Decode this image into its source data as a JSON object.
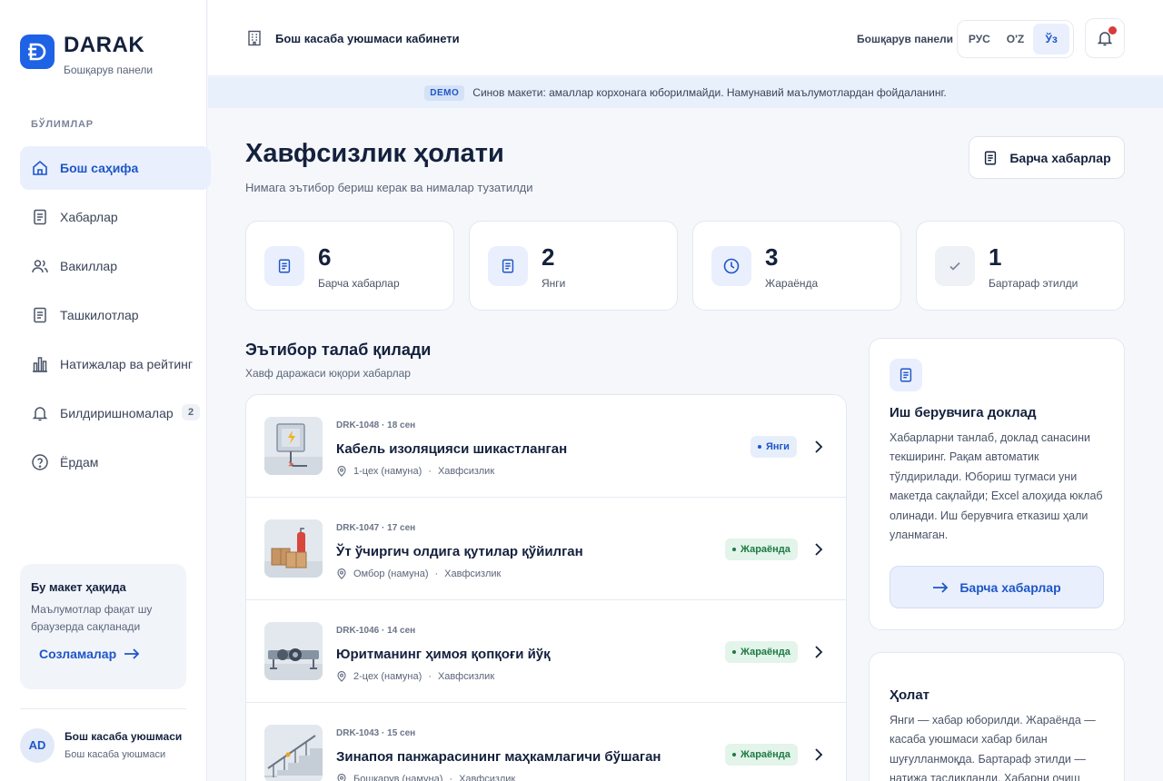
{
  "brand": {
    "name": "DARAK",
    "subtitle": "Бошқарув панели"
  },
  "sidebar": {
    "section_label": "БЎЛИМЛАР",
    "items": [
      {
        "label": "Бош саҳифа",
        "icon": "home-icon",
        "active": true
      },
      {
        "label": "Хабарлар",
        "icon": "document-icon"
      },
      {
        "label": "Вакиллар",
        "icon": "users-icon"
      },
      {
        "label": "Ташкилотлар",
        "icon": "document-icon"
      },
      {
        "label": "Натижалар ва рейтинг",
        "icon": "bar-chart-icon"
      },
      {
        "label": "Билдиришномалар",
        "icon": "bell-icon",
        "badge": "2"
      },
      {
        "label": "Ёрдам",
        "icon": "help-icon"
      }
    ],
    "about": {
      "title": "Бу макет ҳақида",
      "text": "Маълумотлар фақат шу браузерда сақланади",
      "link": "Созламалар"
    },
    "user": {
      "initials": "AD",
      "name": "Бош касаба уюшмаси",
      "org": "Бош касаба уюшмаси"
    }
  },
  "topbar": {
    "title": "Бош касаба уюшмаси кабинети",
    "panel_label": "Бошқарув панели",
    "languages": [
      "РУС",
      "O'Z",
      "Ўз"
    ],
    "active_language": "Ўз"
  },
  "banner": {
    "tag": "DEMO",
    "text": "Синов макети: амаллар корхонага юборилмайди. Намунавий маълумотлардан фойдаланинг."
  },
  "page": {
    "title": "Хавфсизлик ҳолати",
    "subtitle": "Нимага эътибор бериш керак ва нималар тузатилди",
    "all_reports_button": "Барча хабарлар"
  },
  "stats": [
    {
      "value": "6",
      "label": "Барча хабарлар",
      "icon": "document-icon"
    },
    {
      "value": "2",
      "label": "Янги",
      "icon": "document-icon"
    },
    {
      "value": "3",
      "label": "Жараёнда",
      "icon": "clock-icon"
    },
    {
      "value": "1",
      "label": "Бартараф этилди",
      "icon": "check-icon"
    }
  ],
  "attention": {
    "title": "Эътибор талаб қилади",
    "subtitle": "Хавф даражаси юқори хабарлар",
    "reports": [
      {
        "meta": "DRK-1048 · 18 сен",
        "title": "Кабель изоляцияси шикастланган",
        "location": "1-цех (намуна)",
        "category": "Хавфсизлик",
        "status": "Янги",
        "status_type": "new"
      },
      {
        "meta": "DRK-1047 · 17 сен",
        "title": "Ўт ўчиргич олдига қутилар қўйилган",
        "location": "Омбор (намуна)",
        "category": "Хавфсизлик",
        "status": "Жараёнда",
        "status_type": "progress"
      },
      {
        "meta": "DRK-1046 · 14 сен",
        "title": "Юритманинг ҳимоя қопқоғи йўқ",
        "location": "2-цех (намуна)",
        "category": "Хавфсизлик",
        "status": "Жараёнда",
        "status_type": "progress"
      },
      {
        "meta": "DRK-1043 · 15 сен",
        "title": "Зинапоя панжарасининг маҳкамлагичи бўшаган",
        "location": "Бошқарув (намуна)",
        "category": "Хавфсизлик",
        "status": "Жараёнда",
        "status_type": "progress"
      }
    ]
  },
  "report_card": {
    "title": "Иш берувчига доклад",
    "text": "Хабарларни танлаб, доклад санасини текширинг. Рақам автоматик тўлдирилади. Юбориш тугмаси уни макетда сақлайди; Excel алоҳида юклаб олинади. Иш берувчига етказиш ҳали уланмаган.",
    "button": "Барча хабарлар"
  },
  "status_card": {
    "title": "Ҳолат",
    "text": "Янги — хабар юборилди. Жараёнда — касаба уюшмаси хабар билан шуғулланмоқда. Бартараф этилди — натижа тасдиқланди. Хабарни очиш"
  },
  "colors": {
    "accent": "#1e62e6",
    "new_status": "#1e56c9",
    "progress_status": "#1d7a43",
    "notification_dot": "#d93a3a"
  }
}
